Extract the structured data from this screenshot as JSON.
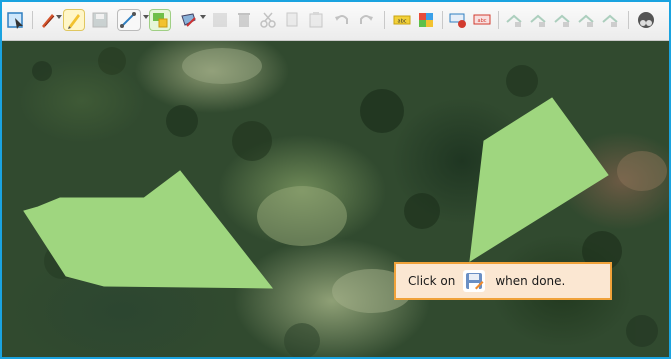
{
  "toolbar": {
    "icons": [
      "select-shape-icon",
      "pencil-red-icon",
      "pencil-yellow-icon",
      "save-icon",
      "draw-line-icon",
      "dropdown-icon",
      "move-node-icon",
      "fill-tool-icon",
      "edit-icon",
      "delete-icon",
      "cut-icon",
      "copy-icon",
      "paste-icon",
      "undo-icon",
      "redo-icon",
      "label-icon",
      "color-palette-icon",
      "add-label-icon",
      "remove-label-icon",
      "layer-icon-1",
      "layer-icon-2",
      "layer-icon-3",
      "layer-icon-4",
      "layer-icon-5",
      "globe-icon"
    ]
  },
  "tooltip": {
    "prefix": "Click on",
    "icon": "save-edits-icon",
    "suffix": "when done."
  },
  "colors": {
    "frame_border": "#1aa3e0",
    "polygon_fill": "#9fd67f",
    "tooltip_bg": "#fbe7d2",
    "tooltip_border": "#f0a23a"
  }
}
